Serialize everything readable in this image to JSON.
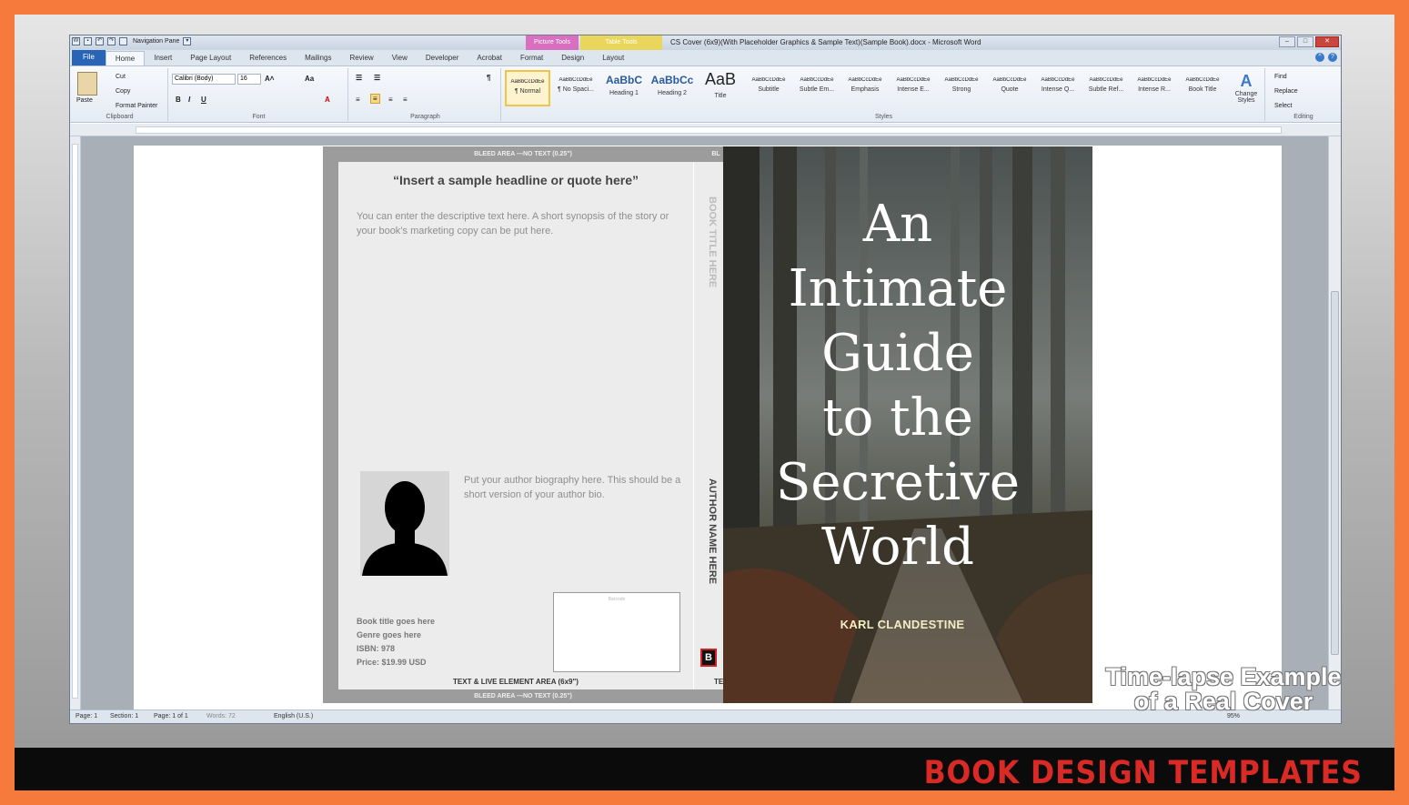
{
  "titlebar": {
    "nav_pane": "Navigation Pane",
    "context_picture": "Picture Tools",
    "context_table": "Table Tools",
    "doc_title": "CS Cover (6x9)(With Placeholder Graphics & Sample Text)(Sample Book).docx - Microsoft Word"
  },
  "tabs": [
    "File",
    "Home",
    "Insert",
    "Page Layout",
    "References",
    "Mailings",
    "Review",
    "View",
    "Developer",
    "Acrobat",
    "Format",
    "Design",
    "Layout"
  ],
  "clipboard": {
    "paste": "Paste",
    "cut": "Cut",
    "copy": "Copy",
    "format_painter": "Format Painter",
    "label": "Clipboard"
  },
  "font": {
    "name": "Calibri (Body)",
    "size": "16",
    "label": "Font"
  },
  "paragraph": {
    "label": "Paragraph"
  },
  "styles": {
    "label": "Styles",
    "items": [
      {
        "preview": "AaBbCcDdEe",
        "name": "¶ Normal"
      },
      {
        "preview": "AaBbCcDdEe",
        "name": "¶ No Spaci..."
      },
      {
        "preview": "AaBbC",
        "name": "Heading 1"
      },
      {
        "preview": "AaBbCc",
        "name": "Heading 2"
      },
      {
        "preview": "AaB",
        "name": "Title"
      },
      {
        "preview": "AaBbCcDdEe",
        "name": "Subtitle"
      },
      {
        "preview": "AaBbCcDdEe",
        "name": "Subtle Em..."
      },
      {
        "preview": "AaBbCcDdEe",
        "name": "Emphasis"
      },
      {
        "preview": "AaBbCcDdEe",
        "name": "Intense E..."
      },
      {
        "preview": "AaBbCcDdEe",
        "name": "Strong"
      },
      {
        "preview": "AaBbCcDdEe",
        "name": "Quote"
      },
      {
        "preview": "AaBbCcDdEe",
        "name": "Intense Q..."
      },
      {
        "preview": "AaBbCcDdEe",
        "name": "Subtle Ref..."
      },
      {
        "preview": "AaBbCcDdEe",
        "name": "Intense R..."
      },
      {
        "preview": "AaBbCcDdEe",
        "name": "Book Title"
      }
    ],
    "change": "Change Styles"
  },
  "editing": {
    "find": "Find",
    "replace": "Replace",
    "select": "Select",
    "label": "Editing"
  },
  "status": {
    "page": "Page: 1",
    "section": "Section: 1",
    "pages": "Page: 1 of 1",
    "words": "Words: 72",
    "lang": "English (U.S.)",
    "zoom": "95%"
  },
  "cover": {
    "bleed_top": "BLEED AREA —NO TEXT (0.25\")",
    "bleed_bottom": "BLEED AREA —NO TEXT (0.25\")",
    "bleed_spine": "BL",
    "headline": "“Insert a sample headline or quote here”",
    "description": "You can enter the descriptive text here. A short synopsis of the story or your book’s marketing copy can be put here.",
    "bio": "Put your author biography here. This should be a short version of your author bio.",
    "info_lines": [
      "Book title goes here",
      "Genre goes here",
      "ISBN: 978",
      "Price: $19.99  USD"
    ],
    "barcode_label": "Barcode",
    "text_area": "TEXT & LIVE ELEMENT AREA (6x9\")",
    "spine_title": "BOOK TITLE HERE",
    "spine_author": "AUTHOR NAME HERE",
    "spine_badge": "B",
    "spine_bottom": "TE",
    "title_lines": [
      "An",
      "Intimate",
      "Guide",
      "to the",
      "Secretive",
      "World"
    ],
    "author": "KARL CLANDESTINE"
  },
  "overlay": {
    "line1": "Time-lapse Example",
    "line2": "of a Real Cover"
  },
  "brand": "BOOK DESIGN TEMPLATES"
}
